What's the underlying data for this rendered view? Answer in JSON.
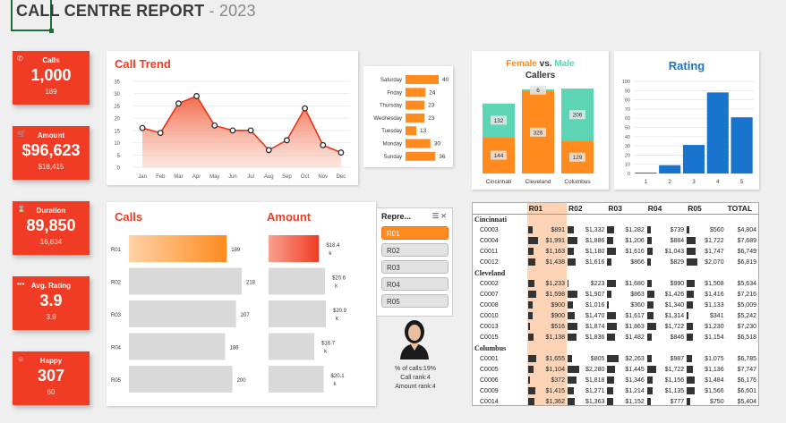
{
  "header": {
    "title": "CALL CENTRE REPORT",
    "year": "- 2023"
  },
  "kpis": [
    {
      "icon": "phone-icon",
      "glyph": "✆",
      "label": "Calls",
      "value": "1,000",
      "sub": "189"
    },
    {
      "icon": "cart-icon",
      "glyph": "🛒",
      "label": "Amount",
      "value": "$96,623",
      "sub": "$18,415"
    },
    {
      "icon": "hourglass-icon",
      "glyph": "⌛",
      "label": "Duration",
      "value": "89,850",
      "sub": "16,834"
    },
    {
      "icon": "dots-icon",
      "glyph": "•••",
      "label": "Avg. Rating",
      "value": "3.9",
      "sub": "3.9"
    },
    {
      "icon": "smile-icon",
      "glyph": "☺",
      "label": "Happy",
      "value": "307",
      "sub": "60"
    }
  ],
  "call_trend": {
    "title": "Call Trend"
  },
  "calls_panel": {
    "title": "Calls",
    "amount_title": "Amount"
  },
  "gender": {
    "title_female": "Female",
    "title_vs": " vs. ",
    "title_male": "Male",
    "title_callers": "Callers"
  },
  "rating": {
    "title": "Rating"
  },
  "slicer": {
    "title": "Repre...",
    "items": [
      "R01",
      "R02",
      "R03",
      "R04",
      "R05"
    ],
    "selected": "R01"
  },
  "rep_info": {
    "pct": "% of calls:19%",
    "call_rank": "Call rank:4",
    "amount_rank": "Amount rank:4"
  },
  "table": {
    "headers": [
      "",
      "R01",
      "R02",
      "R03",
      "R04",
      "R05",
      "TOTAL"
    ],
    "groups": [
      {
        "city": "Cincinnati",
        "rows": [
          [
            "C0003",
            "$891",
            "$1,332",
            "$1,282",
            "$739",
            "$560",
            "$4,804"
          ],
          [
            "C0004",
            "$1,991",
            "$1,886",
            "$1,206",
            "$884",
            "$1,722",
            "$7,689"
          ],
          [
            "C0011",
            "$1,163",
            "$1,180",
            "$1,616",
            "$1,043",
            "$1,747",
            "$6,749"
          ],
          [
            "C0012",
            "$1,438",
            "$1,616",
            "$866",
            "$829",
            "$2,070",
            "$6,819"
          ]
        ]
      },
      {
        "city": "Cleveland",
        "rows": [
          [
            "C0002",
            "$1,233",
            "$223",
            "$1,680",
            "$990",
            "$1,508",
            "$5,634"
          ],
          [
            "C0007",
            "$1,598",
            "$1,907",
            "$863",
            "$1,426",
            "$1,416",
            "$7,216"
          ],
          [
            "C0008",
            "$900",
            "$1,016",
            "$360",
            "$1,340",
            "$1,133",
            "$5,009"
          ],
          [
            "C0010",
            "$900",
            "$1,470",
            "$1,617",
            "$1,314",
            "$341",
            "$5,242"
          ],
          [
            "C0013",
            "$516",
            "$1,874",
            "$1,863",
            "$1,722",
            "$1,230",
            "$7,230"
          ],
          [
            "C0015",
            "$1,138",
            "$1,836",
            "$1,482",
            "$846",
            "$1,154",
            "$6,518"
          ]
        ]
      },
      {
        "city": "Columbus",
        "rows": [
          [
            "C0001",
            "$1,655",
            "$805",
            "$2,263",
            "$987",
            "$1,075",
            "$6,785"
          ],
          [
            "C0005",
            "$1,104",
            "$2,280",
            "$1,445",
            "$1,722",
            "$1,136",
            "$7,747"
          ],
          [
            "C0006",
            "$372",
            "$1,818",
            "$1,346",
            "$1,156",
            "$1,484",
            "$6,176"
          ],
          [
            "C0009",
            "$1,415",
            "$1,271",
            "$1,214",
            "$1,135",
            "$1,566",
            "$6,601"
          ],
          [
            "C0014",
            "$1,362",
            "$1,363",
            "$1,152",
            "$777",
            "$750",
            "$5,404"
          ]
        ]
      }
    ]
  },
  "chart_data": [
    {
      "type": "area",
      "title": "Call Trend",
      "categories": [
        "Jan",
        "Feb",
        "Mar",
        "Apr",
        "May",
        "Jun",
        "Jul",
        "Aug",
        "Sep",
        "Oct",
        "Nov",
        "Dec"
      ],
      "values": [
        16,
        14,
        26,
        29,
        17,
        15,
        15,
        7,
        11,
        24,
        9,
        6
      ],
      "ylim": [
        0,
        35
      ],
      "yticks": [
        0,
        5,
        10,
        15,
        20,
        25,
        30,
        35
      ],
      "grid": true
    },
    {
      "type": "bar",
      "orientation": "horizontal",
      "categories": [
        "Saturday",
        "Friday",
        "Thursday",
        "Wednesday",
        "Tuesday",
        "Monday",
        "Sunday"
      ],
      "values": [
        40,
        24,
        23,
        23,
        13,
        30,
        36
      ]
    },
    {
      "type": "bar",
      "stacked": true,
      "title": "Female vs. Male Callers",
      "categories": [
        "Cincinnati",
        "Cleveland",
        "Columbus"
      ],
      "series": [
        {
          "values": [
            144,
            326,
            129
          ]
        },
        {
          "values": [
            132,
            6,
            206
          ]
        }
      ],
      "colors": [
        "#ff8a1e",
        "#5dd4b3"
      ]
    },
    {
      "type": "bar",
      "title": "Rating",
      "categories": [
        "1",
        "2",
        "3",
        "4",
        "5"
      ],
      "values": [
        1,
        9,
        31,
        88,
        61
      ],
      "ylim": [
        0,
        100
      ],
      "yticks": [
        0,
        10,
        20,
        30,
        40,
        50,
        60,
        70,
        80,
        90,
        100
      ],
      "grid": true
    },
    {
      "type": "bar",
      "orientation": "horizontal",
      "title": "Calls",
      "categories": [
        "R01",
        "R02",
        "R03",
        "R04",
        "R05"
      ],
      "values": [
        189,
        218,
        207,
        186,
        200
      ]
    },
    {
      "type": "bar",
      "orientation": "horizontal",
      "title": "Amount",
      "categories": [
        "R01",
        "R02",
        "R03",
        "R04",
        "R05"
      ],
      "values": [
        18.4,
        20.6,
        20.9,
        16.7,
        20.1
      ],
      "value_labels": [
        "$18.4 k",
        "$20.6 k",
        "$20.9 k",
        "$16.7 k",
        "$20.1 k"
      ]
    }
  ],
  "colors": {
    "accent": "#f03c24",
    "orange": "#ff8a1e",
    "teal": "#5dd4b3",
    "blue": "#1874cd",
    "highlight": "#fcd3b4"
  }
}
